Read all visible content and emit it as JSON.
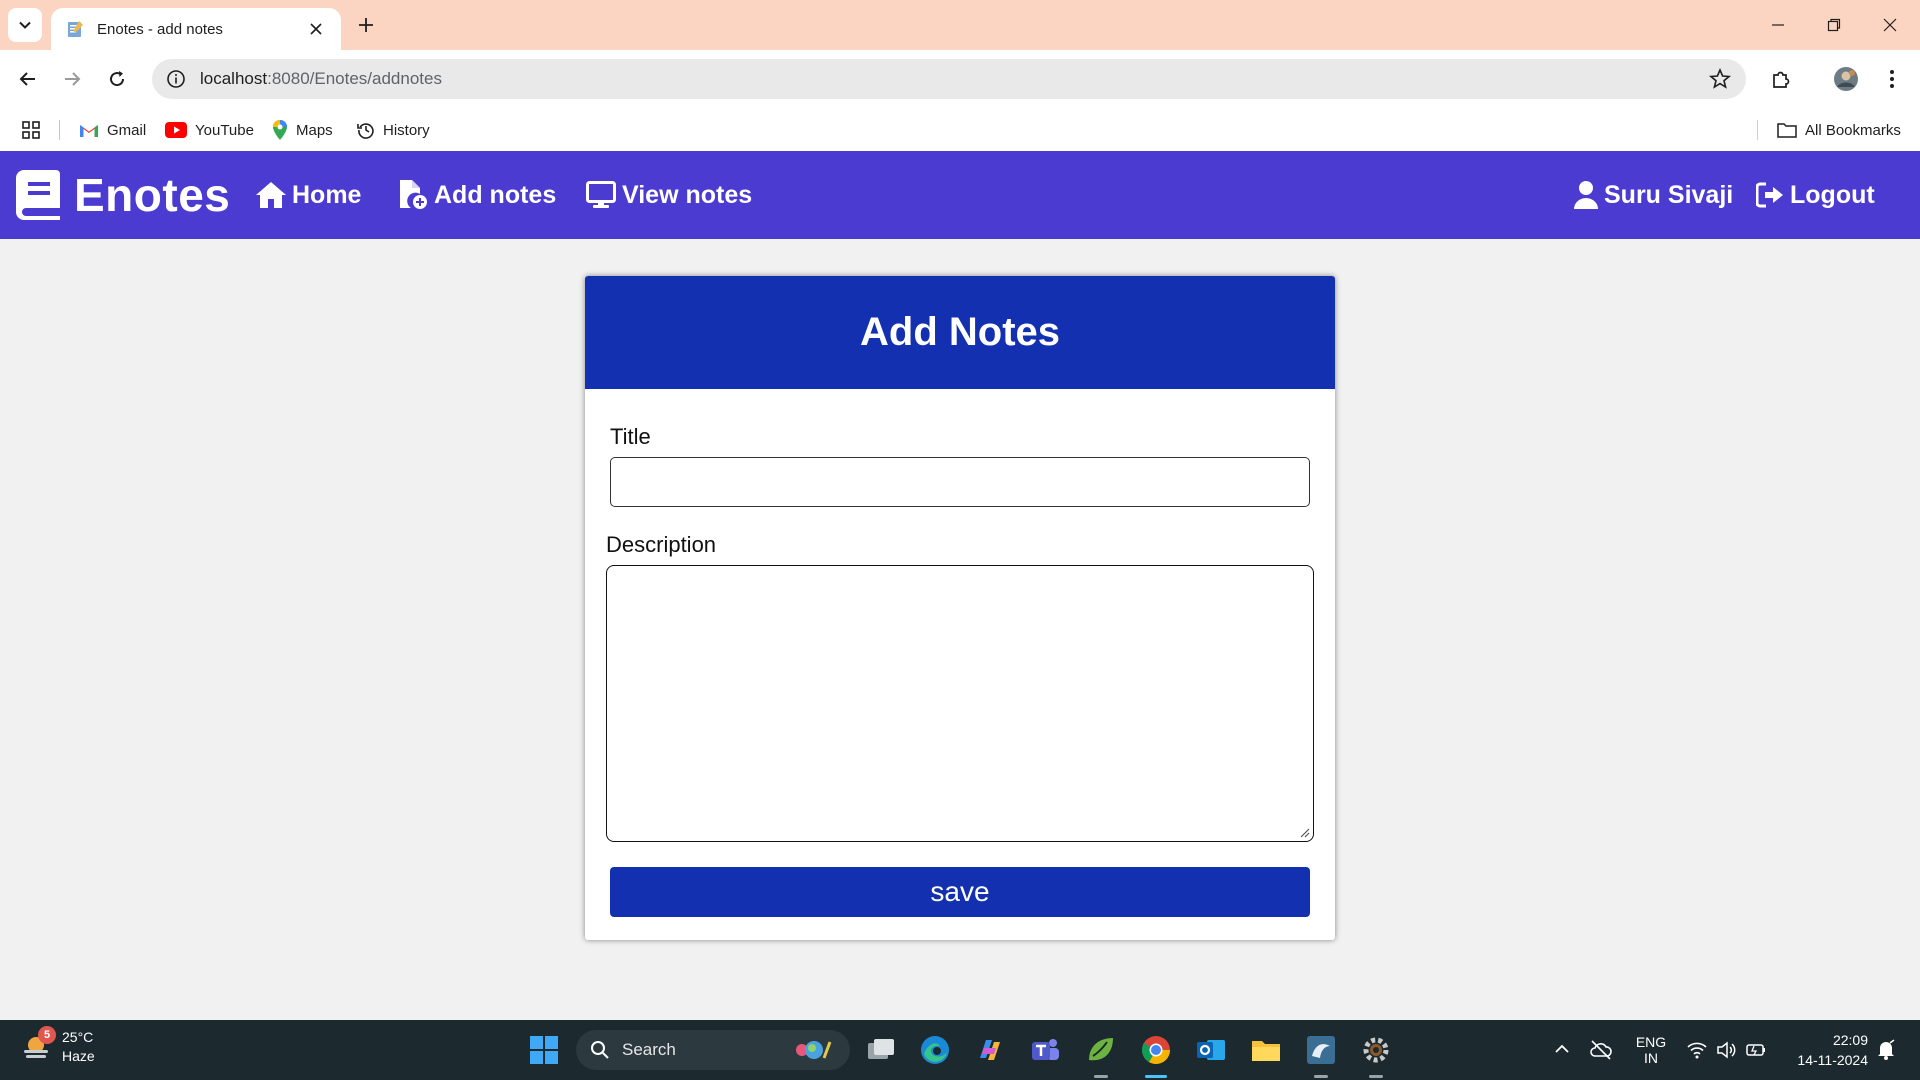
{
  "browser": {
    "tab_title": "Enotes - add notes",
    "url_host": "localhost",
    "url_path": ":8080/Enotes/addnotes",
    "bookmarks": [
      "Gmail",
      "YouTube",
      "Maps",
      "History"
    ],
    "all_bookmarks": "All Bookmarks"
  },
  "navbar": {
    "brand": "Enotes",
    "home": "Home",
    "add_notes": "Add notes",
    "view_notes": "View notes",
    "user": "Suru Sivaji",
    "logout": "Logout",
    "color": "#4b3bd1"
  },
  "form": {
    "header": "Add Notes",
    "title_label": "Title",
    "title_value": "",
    "description_label": "Description",
    "description_value": "",
    "save_label": "save",
    "accent": "#1230b0"
  },
  "taskbar": {
    "weather_temp": "25°C",
    "weather_desc": "Haze",
    "weather_badge": "5",
    "search_label": "Search",
    "lang_top": "ENG",
    "lang_bottom": "IN",
    "time": "22:09",
    "date": "14-11-2024"
  }
}
